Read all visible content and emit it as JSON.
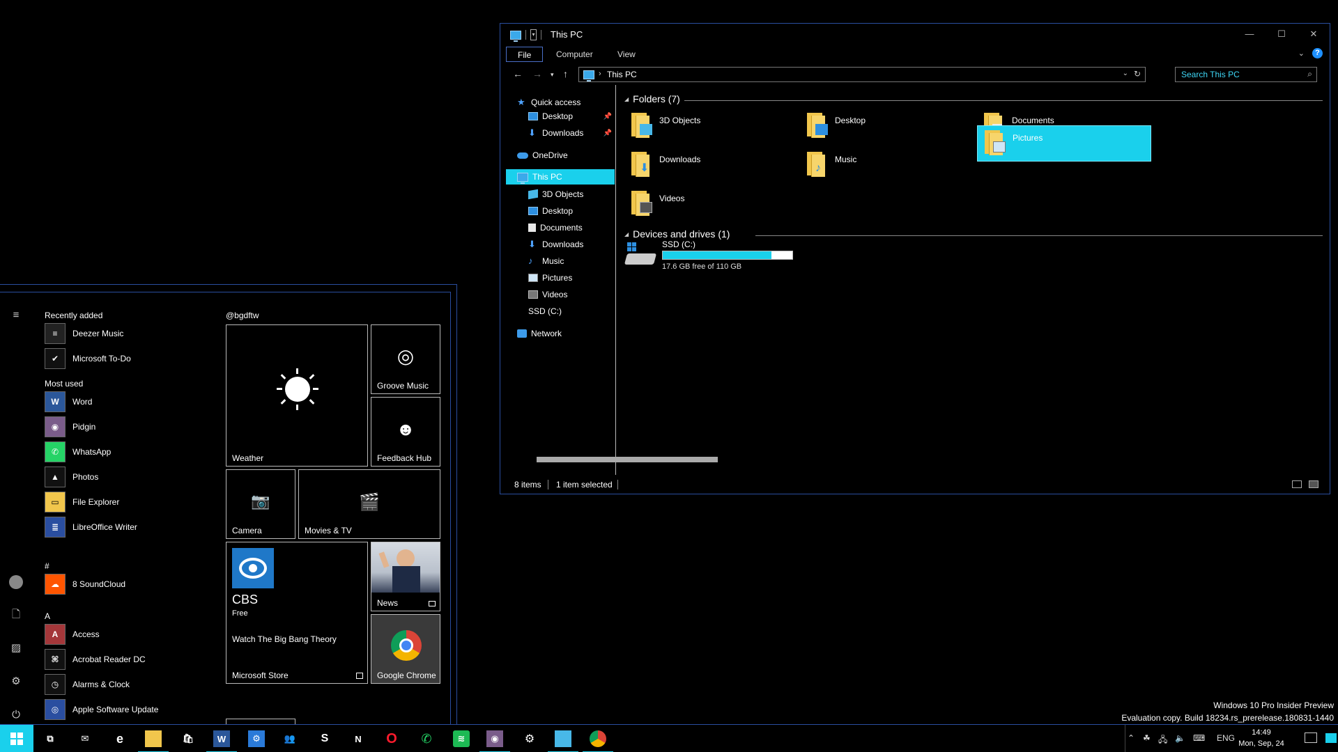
{
  "explorer": {
    "title": "This PC",
    "ribbon_tabs": [
      "File",
      "Computer",
      "View"
    ],
    "address_path": "This PC",
    "search_placeholder": "Search This PC",
    "nav": {
      "quick_access": "Quick access",
      "qa_desktop": "Desktop",
      "qa_downloads": "Downloads",
      "onedrive": "OneDrive",
      "this_pc": "This PC",
      "objects3d": "3D Objects",
      "desktop": "Desktop",
      "documents": "Documents",
      "downloads": "Downloads",
      "music": "Music",
      "pictures": "Pictures",
      "videos": "Videos",
      "ssd": "SSD (C:)",
      "network": "Network"
    },
    "folders_header": "Folders (7)",
    "folders": [
      "3D Objects",
      "Desktop",
      "Documents",
      "Downloads",
      "Music",
      "Pictures",
      "Videos"
    ],
    "selected_folder": "Pictures",
    "devices_header": "Devices and drives (1)",
    "drive": {
      "name": "SSD (C:)",
      "free_text": "17.6 GB free of 110 GB",
      "used_fraction": 0.84
    },
    "status": {
      "items": "8 items",
      "selected": "1 item selected"
    }
  },
  "start_menu": {
    "recently_added_header": "Recently added",
    "recently_added": [
      "Deezer Music",
      "Microsoft To-Do"
    ],
    "most_used_header": "Most used",
    "most_used": [
      "Word",
      "Pidgin",
      "WhatsApp",
      "Photos",
      "File Explorer",
      "LibreOffice Writer"
    ],
    "hash_header": "#",
    "hash_apps": [
      "8 SoundCloud"
    ],
    "a_header": "A",
    "a_apps": [
      "Access",
      "Acrobat Reader DC",
      "Alarms & Clock",
      "Apple Software Update"
    ],
    "tiles_group_title": "@bgdftw",
    "tiles": {
      "weather": "Weather",
      "groove": "Groove Music",
      "feedback": "Feedback Hub",
      "camera": "Camera",
      "movies": "Movies & TV",
      "store_app_name": "CBS",
      "store_price": "Free",
      "store_promo": "Watch The Big Bang Theory",
      "store_label": "Microsoft Store",
      "news": "News",
      "chrome": "Google Chrome"
    }
  },
  "watermark": {
    "line1": "Windows 10 Pro Insider Preview",
    "line2": "Evaluation copy. Build 18234.rs_prerelease.180831-1440"
  },
  "taskbar": {
    "language": "ENG",
    "time": "14:49",
    "date": "Mon, Sep, 24"
  },
  "colors": {
    "accent": "#1ad0ec",
    "border": "#2a4ea0",
    "folder": "#f1c64c"
  }
}
